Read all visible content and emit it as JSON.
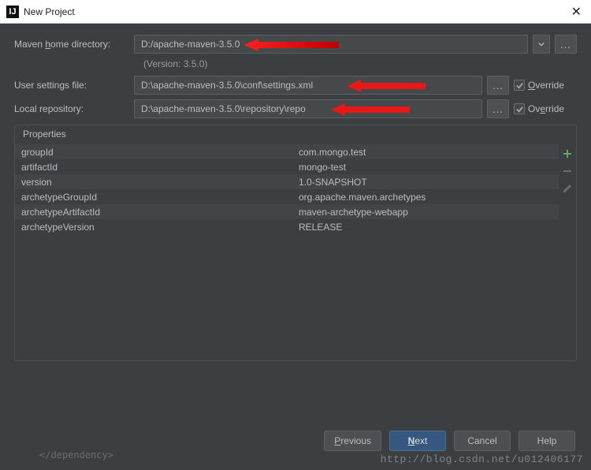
{
  "title": "New Project",
  "labels": {
    "maven_home": "Maven home directory:",
    "maven_home_u": "h",
    "user_settings": "User settings file:",
    "local_repo": "Local repository:",
    "version_note": "(Version: 3.5.0)",
    "override": "Override",
    "properties": "Properties"
  },
  "fields": {
    "maven_home": "D:/apache-maven-3.5.0",
    "user_settings": "D:\\apache-maven-3.5.0\\conf\\settings.xml",
    "local_repo": "D:\\apache-maven-3.5.0\\repository\\repo"
  },
  "override": {
    "user_settings": true,
    "local_repo": true
  },
  "properties": [
    {
      "key": "groupId",
      "value": "com.mongo.test"
    },
    {
      "key": "artifactId",
      "value": "mongo-test"
    },
    {
      "key": "version",
      "value": "1.0-SNAPSHOT"
    },
    {
      "key": "archetypeGroupId",
      "value": "org.apache.maven.archetypes"
    },
    {
      "key": "archetypeArtifactId",
      "value": "maven-archetype-webapp"
    },
    {
      "key": "archetypeVersion",
      "value": "RELEASE"
    }
  ],
  "buttons": {
    "previous": "Previous",
    "next": "Next",
    "cancel": "Cancel",
    "help": "Help"
  },
  "watermark": "http://blog.csdn.net/u012406177",
  "bg_code": "</dependency>",
  "browse": "..."
}
